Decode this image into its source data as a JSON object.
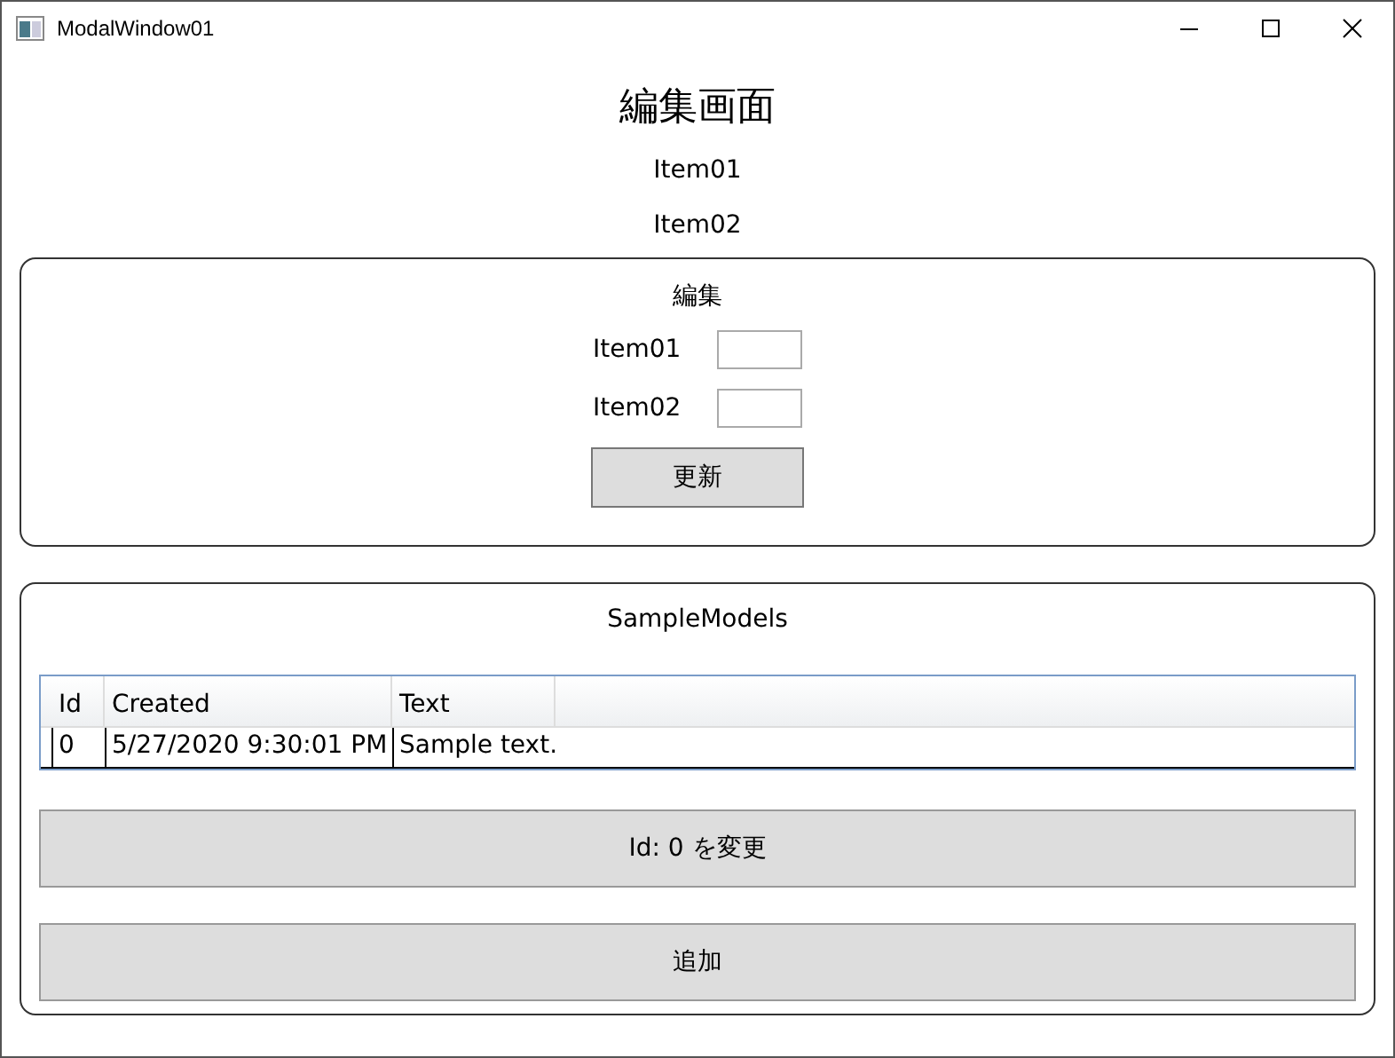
{
  "window": {
    "title": "ModalWindow01"
  },
  "heading": "編集画面",
  "items": [
    "Item01",
    "Item02"
  ],
  "edit_panel": {
    "title": "編集",
    "fields": [
      {
        "label": "Item01"
      },
      {
        "label": "Item02"
      }
    ],
    "button": "更新"
  },
  "models_panel": {
    "title": "SampleModels",
    "table": {
      "columns": [
        "Id",
        "Created",
        "Text"
      ],
      "rows": [
        [
          "0",
          "5/27/2020 9:30:01 PM",
          "Sample text."
        ]
      ]
    },
    "buttons": [
      "Id: 0 を変更",
      "追加"
    ]
  }
}
